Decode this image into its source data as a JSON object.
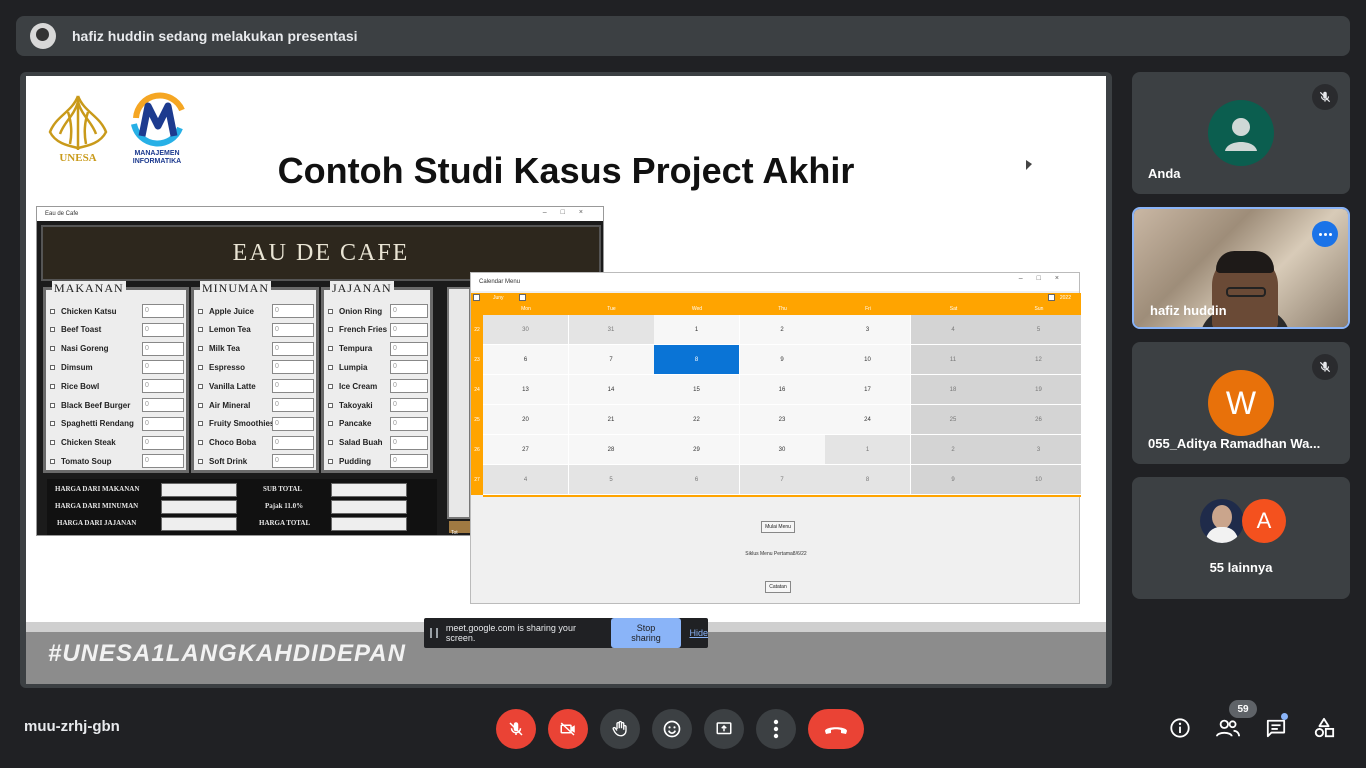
{
  "banner": {
    "presenter_text": "hafiz huddin sedang melakukan presentasi"
  },
  "slide": {
    "title": "Contoh Studi Kasus Project Akhir",
    "logo_unesa_text": "UNESA",
    "logo_mi_line1": "MANAJEMEN",
    "logo_mi_line2": "INFORMATIKA",
    "hashtag": "#UNESA1LANGKAHDIDEPAN",
    "colors": {
      "unesa_gold": "#c99a1a",
      "mi_blue": "#1d3b8f",
      "footer_grey": "#8c8c8c"
    }
  },
  "cafe_app": {
    "window_title": "Eau de Cafe",
    "header": "EAU DE CAFE",
    "default_qty": "0",
    "panels": [
      {
        "title": "MAKANAN",
        "items": [
          "Chicken Katsu",
          "Beef Toast",
          "Nasi Goreng",
          "Dimsum",
          "Rice Bowl",
          "Black Beef Burger",
          "Spaghetti Rendang",
          "Chicken Steak",
          "Tomato Soup"
        ]
      },
      {
        "title": "MINUMAN",
        "items": [
          "Apple Juice",
          "Lemon Tea",
          "Milk Tea",
          "Espresso",
          "Vanilla Latte",
          "Air Mineral",
          "Fruity Smoothies",
          "Choco Boba",
          "Soft Drink"
        ]
      },
      {
        "title": "JAJANAN",
        "items": [
          "Onion Ring",
          "French Fries",
          "Tempura",
          "Lumpia",
          "Ice Cream",
          "Takoyaki",
          "Pancake",
          "Salad Buah",
          "Pudding"
        ]
      }
    ],
    "summary": {
      "harga_makanan": "HARGA DARI MAKANAN",
      "harga_minuman": "HARGA DARI MINUMAN",
      "harga_jajanan": "HARGA DARI JAJANAN",
      "sub_total": "SUB TOTAL",
      "pajak": "Pajak 11.0%",
      "harga_total": "HARGA TOTAL"
    },
    "side_button": "Tot"
  },
  "calendar_app": {
    "window_title": "Calendar Menu",
    "month": "Juny",
    "year": "2022",
    "days": [
      "Mon",
      "Tue",
      "Wed",
      "Thu",
      "Fri",
      "Sat",
      "Sun"
    ],
    "weeks": [
      "22",
      "23",
      "24",
      "25",
      "26",
      "27"
    ],
    "rows": [
      [
        "30",
        "31",
        "1",
        "2",
        "3",
        "4",
        "5"
      ],
      [
        "6",
        "7",
        "8",
        "9",
        "10",
        "11",
        "12"
      ],
      [
        "13",
        "14",
        "15",
        "16",
        "17",
        "18",
        "19"
      ],
      [
        "20",
        "21",
        "22",
        "23",
        "24",
        "25",
        "26"
      ],
      [
        "27",
        "28",
        "29",
        "30",
        "1",
        "2",
        "3"
      ],
      [
        "4",
        "5",
        "6",
        "7",
        "8",
        "9",
        "10"
      ]
    ],
    "selected_date": "8",
    "button_mulai": "Mulai Menu",
    "info_text": "Siklus Menu Pertama8/6/22",
    "button_catatan": "Catatan",
    "colors": {
      "header": "#ffa400",
      "selected": "#0a74d6",
      "weekend": "#d4d4d4",
      "other_month": "#e4e4e4",
      "weekday": "#f7f7f7"
    }
  },
  "share_bar": {
    "text": "meet.google.com is sharing your screen.",
    "stop_label": "Stop sharing",
    "hide_label": "Hide"
  },
  "participants": [
    {
      "name": "Anda",
      "muted": true,
      "avatar_color": "#0b5e4f"
    },
    {
      "name": "hafiz huddin",
      "active": true
    },
    {
      "name": "055_Aditya Ramadhan Wa...",
      "muted": true,
      "initial": "W",
      "avatar_color": "#e8710a"
    },
    {
      "name": "55 lainnya",
      "initial": "A",
      "avatar_color": "#f4511e"
    }
  ],
  "bottom_bar": {
    "meeting_code": "muu-zrhj-gbn",
    "people_count": "59",
    "icons": [
      "mic-off-icon",
      "camera-off-icon",
      "raise-hand-icon",
      "emoji-icon",
      "present-icon",
      "more-vert-icon",
      "hangup-icon",
      "info-icon",
      "people-icon",
      "chat-icon",
      "activities-icon"
    ],
    "colors": {
      "danger": "#ea4335",
      "control": "#3c4043",
      "accent": "#8ab4f8"
    }
  }
}
